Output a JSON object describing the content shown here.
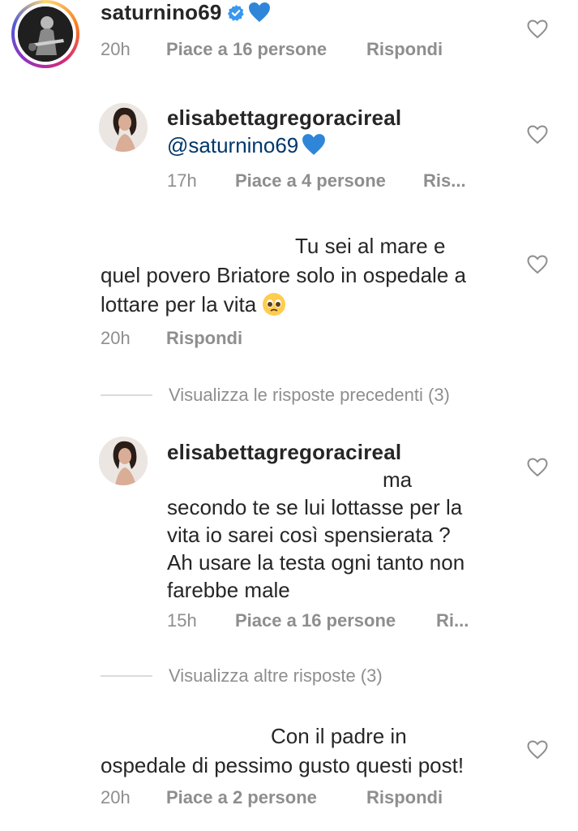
{
  "comment1": {
    "username": "saturnino69",
    "time": "20h",
    "likes": "Piace a 16 persone",
    "reply": "Rispondi"
  },
  "reply1": {
    "username": "elisabettagregoracireal",
    "text": "@saturnino69",
    "time": "17h",
    "likes": "Piace a 4 persone",
    "reply": "Ris..."
  },
  "comment2": {
    "text_line1": "Tu sei al mare e",
    "text_line2": "quel povero Briatore solo in ospedale a",
    "text_line3": "lottare per la vita",
    "time": "20h",
    "reply": "Rispondi"
  },
  "view_previous": "Visualizza le risposte precedenti (3)",
  "reply2": {
    "username": "elisabettagregoracireal",
    "text_line1": "ma",
    "text_line2": "secondo te se lui lottasse per la",
    "text_line3": "vita io sarei così spensierata ?",
    "text_line4": "Ah usare la testa ogni tanto non",
    "text_line5": "farebbe male",
    "time": "15h",
    "likes": "Piace a 16 persone",
    "reply": "Ri..."
  },
  "view_more": "Visualizza altre risposte (3)",
  "comment3": {
    "text_line1": "Con il padre in",
    "text_line2": "ospedale di pessimo gusto questi post!",
    "time": "20h",
    "likes": "Piace a 2 persone",
    "reply": "Rispondi"
  },
  "icons": {
    "heart": "heart-outline-icon",
    "verified": "verified-badge-icon",
    "blue_heart": "blue-heart-emoji",
    "pleading": "pleading-face-emoji"
  },
  "colors": {
    "secondary_text": "#8e8e8e",
    "verified_blue": "#3897f0",
    "heart_blue": "#2f86d8"
  }
}
